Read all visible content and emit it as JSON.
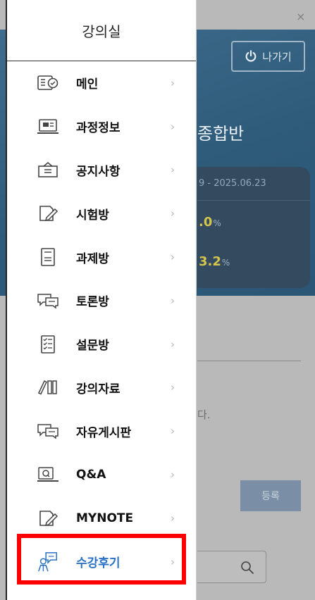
{
  "background": {
    "close_label": "×",
    "exit_label": "나가기",
    "course_title_fragment": "종합반",
    "period_fragment": "9 - 2025.06.23",
    "stat1_value": ".0",
    "stat1_unit": "%",
    "stat2_value": "3.2",
    "stat2_unit": "%",
    "notice_fragment": "다.",
    "register_label": "등록"
  },
  "drawer": {
    "title": "강의실",
    "items": [
      {
        "label": "메인",
        "icon": "main-icon"
      },
      {
        "label": "과정정보",
        "icon": "course-info-icon"
      },
      {
        "label": "공지사항",
        "icon": "notice-icon"
      },
      {
        "label": "시험방",
        "icon": "exam-icon"
      },
      {
        "label": "과제방",
        "icon": "assignment-icon"
      },
      {
        "label": "토론방",
        "icon": "discussion-icon"
      },
      {
        "label": "설문방",
        "icon": "survey-icon"
      },
      {
        "label": "강의자료",
        "icon": "materials-icon"
      },
      {
        "label": "자유게시판",
        "icon": "board-icon"
      },
      {
        "label": "Q&A",
        "icon": "qna-icon"
      },
      {
        "label": "MYNOTE",
        "icon": "note-icon"
      },
      {
        "label": "수강후기",
        "icon": "review-icon"
      }
    ],
    "chevron": "›"
  },
  "colors": {
    "active": "#2a72c6",
    "highlight": "#ff0000"
  }
}
